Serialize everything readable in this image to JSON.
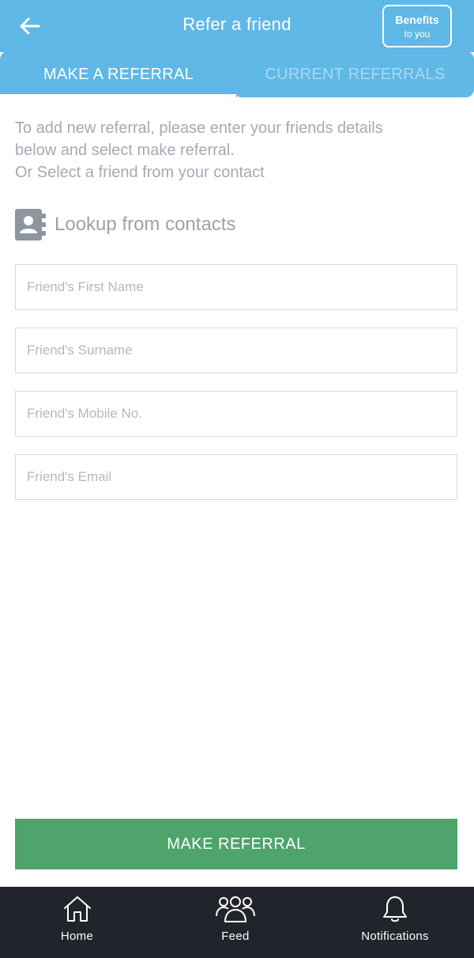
{
  "header": {
    "title": "Refer a friend",
    "back_icon": "arrow-left-icon",
    "benefits_label": "Benefits",
    "benefits_sub": "to you"
  },
  "tabs": [
    {
      "label": "MAKE A REFERRAL",
      "active": true
    },
    {
      "label": "CURRENT REFERRALS",
      "active": false
    }
  ],
  "intro": {
    "line1": "To add new referral, please enter your friends details",
    "line2": "below and select make referral.",
    "line3": "Or Select a friend from your contact"
  },
  "lookup": {
    "label": "Lookup from contacts",
    "icon": "contact-book-icon"
  },
  "form": {
    "first_name": {
      "placeholder": "Friend's First Name",
      "value": ""
    },
    "surname": {
      "placeholder": "Friend's Surname",
      "value": ""
    },
    "mobile": {
      "placeholder": "Friend's Mobile No.",
      "value": ""
    },
    "email": {
      "placeholder": "Friend's Email",
      "value": ""
    }
  },
  "submit_label": "MAKE REFERRAL",
  "nav": [
    {
      "label": "Home",
      "icon": "home-icon"
    },
    {
      "label": "Feed",
      "icon": "group-icon"
    },
    {
      "label": "Notifications",
      "icon": "bell-icon"
    }
  ],
  "colors": {
    "header_bg": "#5fb8e6",
    "button_green": "#4ea46b",
    "nav_bg": "#22242c",
    "muted_text": "#a3abb5"
  }
}
